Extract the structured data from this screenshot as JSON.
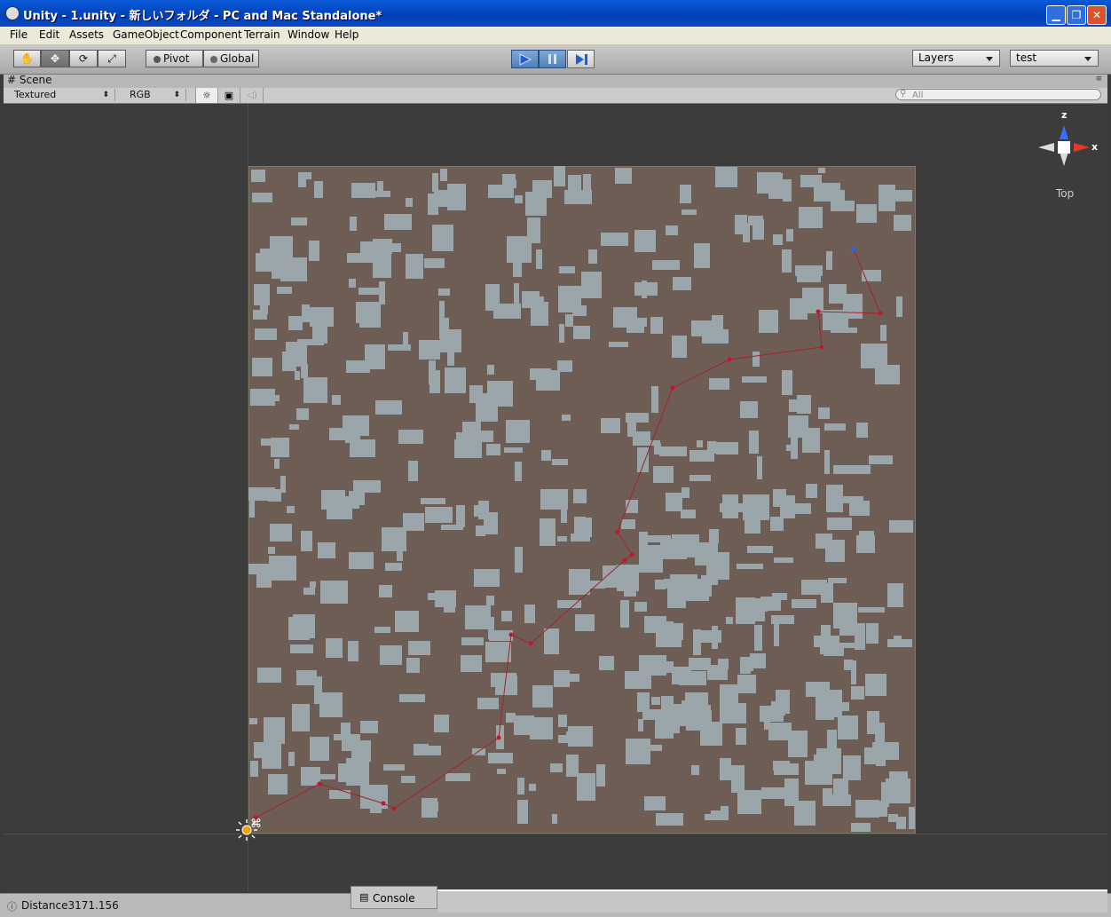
{
  "window": {
    "title": "Unity - 1.unity - 新しいフォルダ - PC and Mac Standalone*"
  },
  "menu": {
    "items": [
      "File",
      "Edit",
      "Assets",
      "GameObject",
      "Component",
      "Terrain",
      "Window",
      "Help"
    ]
  },
  "toolbar": {
    "pivot_label": "Pivot",
    "global_label": "Global",
    "layers_label": "Layers",
    "layout_label": "test"
  },
  "scene_tab": {
    "label": "Scene"
  },
  "scene_bar": {
    "render_mode": "Textured",
    "color_mode": "RGB",
    "search_placeholder": "All"
  },
  "gizmo": {
    "x_label": "x",
    "z_label": "z",
    "view_label": "Top"
  },
  "colors": {
    "ground": "#6e5d55",
    "building": "#9aa6aa",
    "path": "#b0232e",
    "waypoint": "#c8142a",
    "goal": "#2266ff",
    "viewport_bg": "#3c3c3c"
  },
  "status": {
    "message": "Distance3171.156"
  },
  "console_tab": {
    "label": "Console"
  }
}
